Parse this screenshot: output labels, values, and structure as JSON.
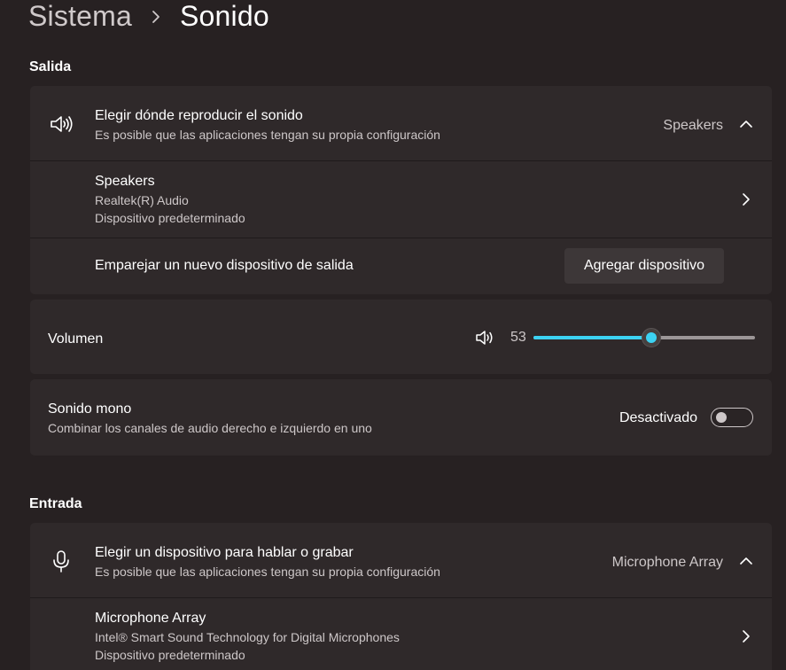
{
  "breadcrumb": {
    "parent": "Sistema",
    "separator": "›",
    "current": "Sonido"
  },
  "output": {
    "section_title": "Salida",
    "choose_device": {
      "title": "Elegir dónde reproducir el sonido",
      "subtitle": "Es posible que las aplicaciones tengan su propia configuración",
      "selected": "Speakers",
      "icon": "speaker-icon",
      "expanded": true
    },
    "device": {
      "name": "Speakers",
      "driver": "Realtek(R) Audio",
      "status": "Dispositivo predeterminado"
    },
    "pair": {
      "label": "Emparejar un nuevo dispositivo de salida",
      "button": "Agregar dispositivo"
    },
    "volume": {
      "label": "Volumen",
      "value": "53",
      "level": 0.53,
      "icon": "speaker-icon"
    },
    "mono": {
      "title": "Sonido mono",
      "subtitle": "Combinar los canales de audio derecho e izquierdo en uno",
      "state": "Desactivado",
      "on": false
    }
  },
  "input": {
    "section_title": "Entrada",
    "choose_device": {
      "title": "Elegir un dispositivo para hablar o grabar",
      "subtitle": "Es posible que las aplicaciones tengan su propia configuración",
      "selected": "Microphone Array",
      "icon": "microphone-icon",
      "expanded": true
    },
    "device": {
      "name": "Microphone Array",
      "driver": "Intel® Smart Sound Technology for Digital Microphones",
      "status": "Dispositivo predeterminado"
    }
  },
  "colors": {
    "accent": "#3cd2f2",
    "background": "#272122",
    "card": "#2f292a"
  }
}
